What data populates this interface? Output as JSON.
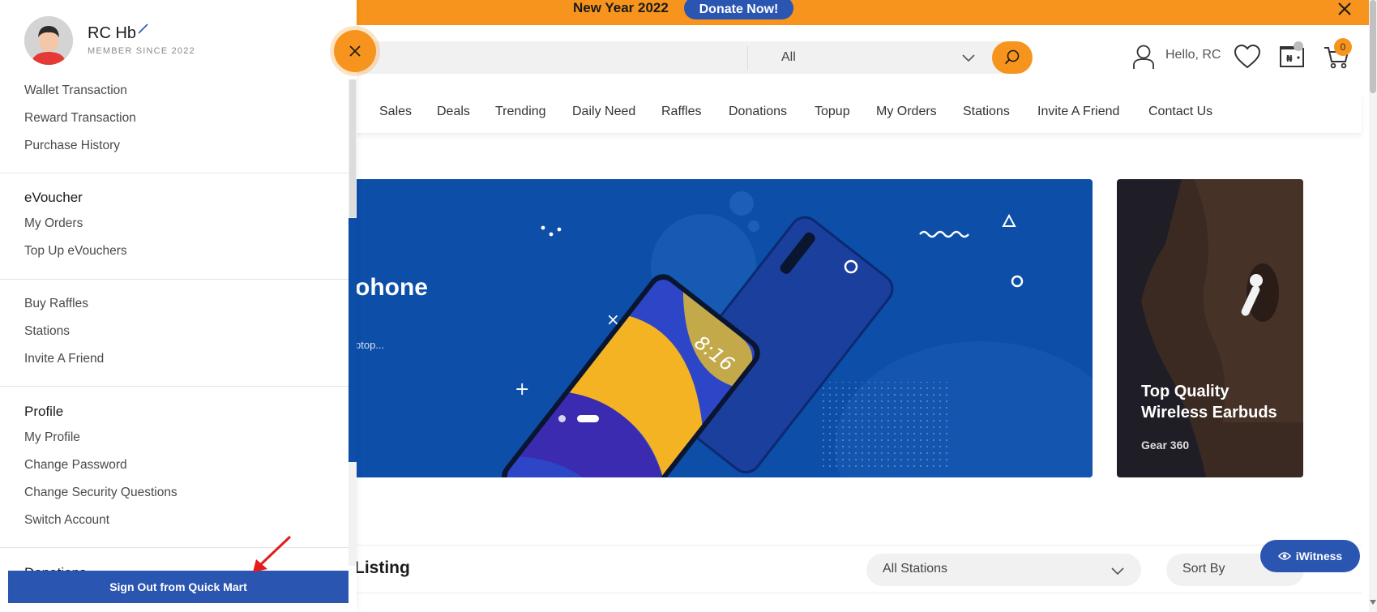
{
  "banner": {
    "text": "New Year 2022",
    "donate_label": "Donate Now!"
  },
  "header": {
    "search_category": "All",
    "greeting": "Hello, RC",
    "cart_count": "0"
  },
  "nav": {
    "items": [
      "Sales",
      "Deals",
      "Trending",
      "Daily Need",
      "Raffles",
      "Donations",
      "Topup",
      "My Orders",
      "Stations",
      "Invite A Friend",
      "Contact Us"
    ]
  },
  "hero": {
    "title": "ohone",
    "subtitle": "ptop..."
  },
  "promo": {
    "title": "Top Quality Wireless Earbuds",
    "subtitle": "Gear 360"
  },
  "listing": {
    "title": "Listing",
    "stations_value": "All Stations",
    "sort_value": "Sort By"
  },
  "iwitness_label": "iWitness",
  "drawer": {
    "user_name": "RC Hb",
    "member_since": "MEMBER SINCE 2022",
    "account_links": [
      "Wallet Transaction",
      "Reward Transaction",
      "Purchase History"
    ],
    "evoucher": {
      "heading": "eVoucher",
      "links": [
        "My Orders",
        "Top Up eVouchers"
      ]
    },
    "misc_links": [
      "Buy Raffles",
      "Stations",
      "Invite A Friend"
    ],
    "profile": {
      "heading": "Profile",
      "links": [
        "My Profile",
        "Change Password",
        "Change Security Questions",
        "Switch Account"
      ]
    },
    "donations_heading": "Donations",
    "signout_label": "Sign Out from Quick Mart"
  },
  "colors": {
    "accent": "#f7941d",
    "brand_blue": "#2a55b0",
    "hero_blue": "#0c4ea8"
  }
}
